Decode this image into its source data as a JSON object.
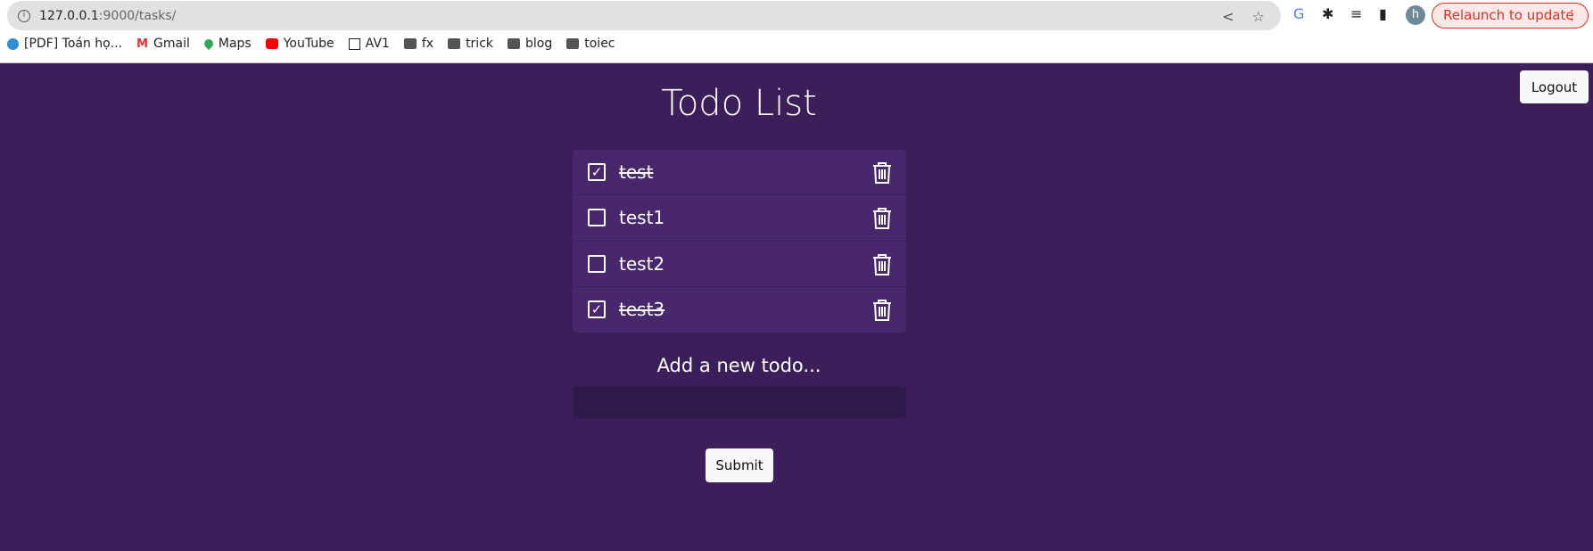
{
  "browser": {
    "url_host": "127.0.0.1",
    "url_path": ":9000/tasks/",
    "relaunch_label": "Relaunch to update",
    "avatar_letter": "h",
    "bookmarks": [
      {
        "label": "[PDF] Toán họ...",
        "icon": "wordpress-icon"
      },
      {
        "label": "Gmail",
        "icon": "gmail-icon"
      },
      {
        "label": "Maps",
        "icon": "maps-icon"
      },
      {
        "label": "YouTube",
        "icon": "youtube-icon"
      },
      {
        "label": "AV1",
        "icon": "notion-icon"
      },
      {
        "label": "fx",
        "icon": "folder-icon"
      },
      {
        "label": "trick",
        "icon": "folder-icon"
      },
      {
        "label": "blog",
        "icon": "folder-icon"
      },
      {
        "label": "toiec",
        "icon": "folder-icon"
      }
    ]
  },
  "page": {
    "title": "Todo List",
    "logout_label": "Logout",
    "add_label": "Add a new todo...",
    "input_value": "",
    "submit_label": "Submit",
    "background": "#3c1f5a",
    "todos": [
      {
        "text": "test",
        "done": true
      },
      {
        "text": "test1",
        "done": false
      },
      {
        "text": "test2",
        "done": false
      },
      {
        "text": "test3",
        "done": true
      }
    ]
  }
}
